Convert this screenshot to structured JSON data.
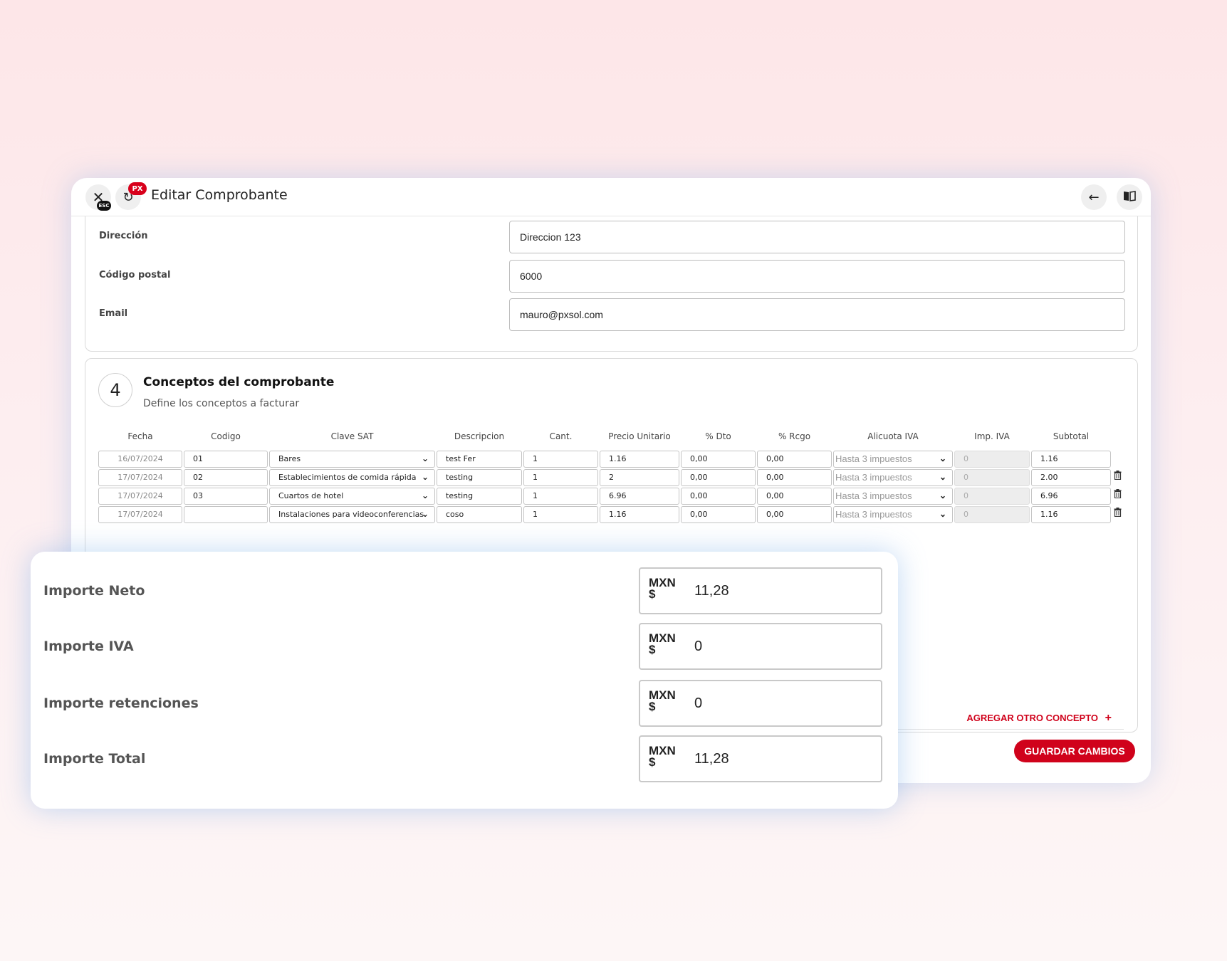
{
  "window": {
    "title": "Editar Comprobante",
    "esc_badge": "ESC",
    "px_badge": "PX",
    "icons": {
      "close": "close-icon",
      "refresh": "refresh-icon",
      "back": "arrow-left-icon",
      "book": "book-icon"
    }
  },
  "client": {
    "fields": [
      {
        "label": "Dirección",
        "value": "Direccion 123"
      },
      {
        "label": "Código postal",
        "value": "6000"
      },
      {
        "label": "Email",
        "value": "mauro@pxsol.com"
      }
    ]
  },
  "concepts": {
    "step": "4",
    "title": "Conceptos del comprobante",
    "subtitle": "Define los conceptos a facturar",
    "columns": [
      "Fecha",
      "Codigo",
      "Clave SAT",
      "Descripcion",
      "Cant.",
      "Precio Unitario",
      "% Dto",
      "% Rcgo",
      "Alicuota IVA",
      "Imp. IVA",
      "Subtotal"
    ],
    "rows": [
      {
        "fecha": "16/07/2024",
        "codigo": "01",
        "clave_sat": "Bares",
        "descripcion": "test Fer",
        "cant": "1",
        "precio": "1.16",
        "dto": "0,00",
        "rcgo": "0,00",
        "alicuota": "Hasta 3 impuestos",
        "imp_iva": "0",
        "subtotal": "1.16",
        "deletable": false
      },
      {
        "fecha": "17/07/2024",
        "codigo": "02",
        "clave_sat": "Establecimientos de comida rápida",
        "descripcion": "testing",
        "cant": "1",
        "precio": "2",
        "dto": "0,00",
        "rcgo": "0,00",
        "alicuota": "Hasta 3 impuestos",
        "imp_iva": "0",
        "subtotal": "2.00",
        "deletable": true
      },
      {
        "fecha": "17/07/2024",
        "codigo": "03",
        "clave_sat": "Cuartos de hotel",
        "descripcion": "testing",
        "cant": "1",
        "precio": "6.96",
        "dto": "0,00",
        "rcgo": "0,00",
        "alicuota": "Hasta 3 impuestos",
        "imp_iva": "0",
        "subtotal": "6.96",
        "deletable": true
      },
      {
        "fecha": "17/07/2024",
        "codigo": "",
        "clave_sat": "Instalaciones para videoconferencias",
        "descripcion": "coso",
        "cant": "1",
        "precio": "1.16",
        "dto": "0,00",
        "rcgo": "0,00",
        "alicuota": "Hasta 3 impuestos",
        "imp_iva": "0",
        "subtotal": "1.16",
        "deletable": true
      }
    ],
    "add_label": "AGREGAR OTRO CONCEPTO",
    "add_icon": "+"
  },
  "save_label": "GUARDAR CAMBIOS",
  "totals": [
    {
      "label": "Importe Neto",
      "currency": "MXN $",
      "value": "11,28"
    },
    {
      "label": "Importe IVA",
      "currency": "MXN $",
      "value": "0"
    },
    {
      "label": "Importe retenciones",
      "currency": "MXN $",
      "value": "0"
    },
    {
      "label": "Importe Total",
      "currency": "MXN $",
      "value": "11,28"
    }
  ],
  "colors": {
    "accent": "#d0021b",
    "background": "#fde6e8"
  }
}
